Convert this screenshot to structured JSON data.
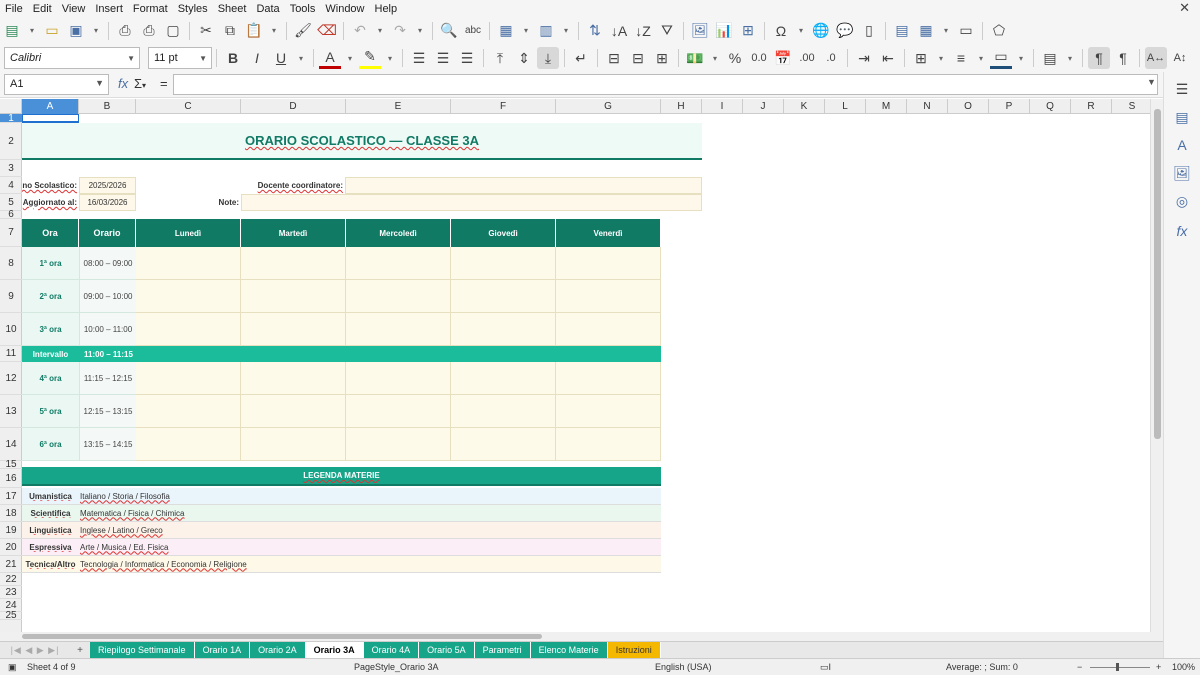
{
  "menu": [
    "File",
    "Edit",
    "View",
    "Insert",
    "Format",
    "Styles",
    "Sheet",
    "Data",
    "Tools",
    "Window",
    "Help"
  ],
  "font": {
    "name": "Calibri",
    "size": "11 pt"
  },
  "namebox": "A1",
  "columns": [
    "A",
    "B",
    "C",
    "D",
    "E",
    "F",
    "G",
    "H",
    "I",
    "J",
    "K",
    "L",
    "M",
    "N",
    "O",
    "P",
    "Q",
    "R",
    "S"
  ],
  "rows": [
    "1",
    "2",
    "3",
    "4",
    "5",
    "6",
    "7",
    "8",
    "9",
    "10",
    "11",
    "12",
    "13",
    "14",
    "15",
    "16",
    "17",
    "18",
    "19",
    "20",
    "21",
    "22",
    "23",
    "24",
    "25"
  ],
  "sheet": {
    "title": "ORARIO SCOLASTICO — CLASSE 3A",
    "anno_label": "Anno Scolastico:",
    "anno_value": "2025/2026",
    "docente_label": "Docente coordinatore:",
    "aggiornato_label": "Aggiornato al:",
    "aggiornato_value": "16/03/2026",
    "note_label": "Note:",
    "headers": [
      "Ora",
      "Orario",
      "Lunedì",
      "Martedì",
      "Mercoledì",
      "Giovedì",
      "Venerdì"
    ],
    "lessons": [
      {
        "ora": "1ª ora",
        "orario": "08:00 – 09:00"
      },
      {
        "ora": "2ª ora",
        "orario": "09:00 – 10:00"
      },
      {
        "ora": "3ª ora",
        "orario": "10:00 – 11:00"
      },
      {
        "ora": "4ª ora",
        "orario": "11:15 – 12:15"
      },
      {
        "ora": "5ª ora",
        "orario": "12:15 – 13:15"
      },
      {
        "ora": "6ª ora",
        "orario": "13:15 – 14:15"
      }
    ],
    "intervallo": {
      "label": "Intervallo",
      "time": "11:00 – 11:15"
    },
    "legend_title": "LEGENDA MATERIE",
    "legend": [
      {
        "cat": "Umanistica",
        "subjects": "Italiano / Storia / Filosofia",
        "color": "#eaf4fb"
      },
      {
        "cat": "Scientifica",
        "subjects": "Matematica / Fisica / Chimica",
        "color": "#e9f7ef"
      },
      {
        "cat": "Linguistica",
        "subjects": "Inglese / Latino / Greco",
        "color": "#fdf2e9"
      },
      {
        "cat": "Espressiva",
        "subjects": "Arte / Musica / Ed. Fisica",
        "color": "#fbeef6"
      },
      {
        "cat": "Tecnica/Altro",
        "subjects": "Tecnologia / Informatica / Economia / Religione",
        "color": "#fdf8e8"
      }
    ]
  },
  "tabs": [
    {
      "label": "Riepilogo Settimanale",
      "style": "teal"
    },
    {
      "label": "Orario 1A",
      "style": "teal"
    },
    {
      "label": "Orario 2A",
      "style": "teal"
    },
    {
      "label": "Orario 3A",
      "style": "active"
    },
    {
      "label": "Orario 4A",
      "style": "teal"
    },
    {
      "label": "Orario 5A",
      "style": "teal"
    },
    {
      "label": "Parametri",
      "style": "teal"
    },
    {
      "label": "Elenco Materie",
      "style": "teal"
    },
    {
      "label": "Istruzioni",
      "style": "orange"
    }
  ],
  "status": {
    "sheet": "Sheet 4 of 9",
    "pagestyle": "PageStyle_Orario 3A",
    "lang": "English (USA)",
    "summary": "Average: ; Sum: 0",
    "zoom": "100%"
  },
  "colors": {
    "teal_dark": "#117a65",
    "teal": "#1abc9c",
    "cream": "#fdfaea",
    "title_bg": "#eefaf6"
  }
}
